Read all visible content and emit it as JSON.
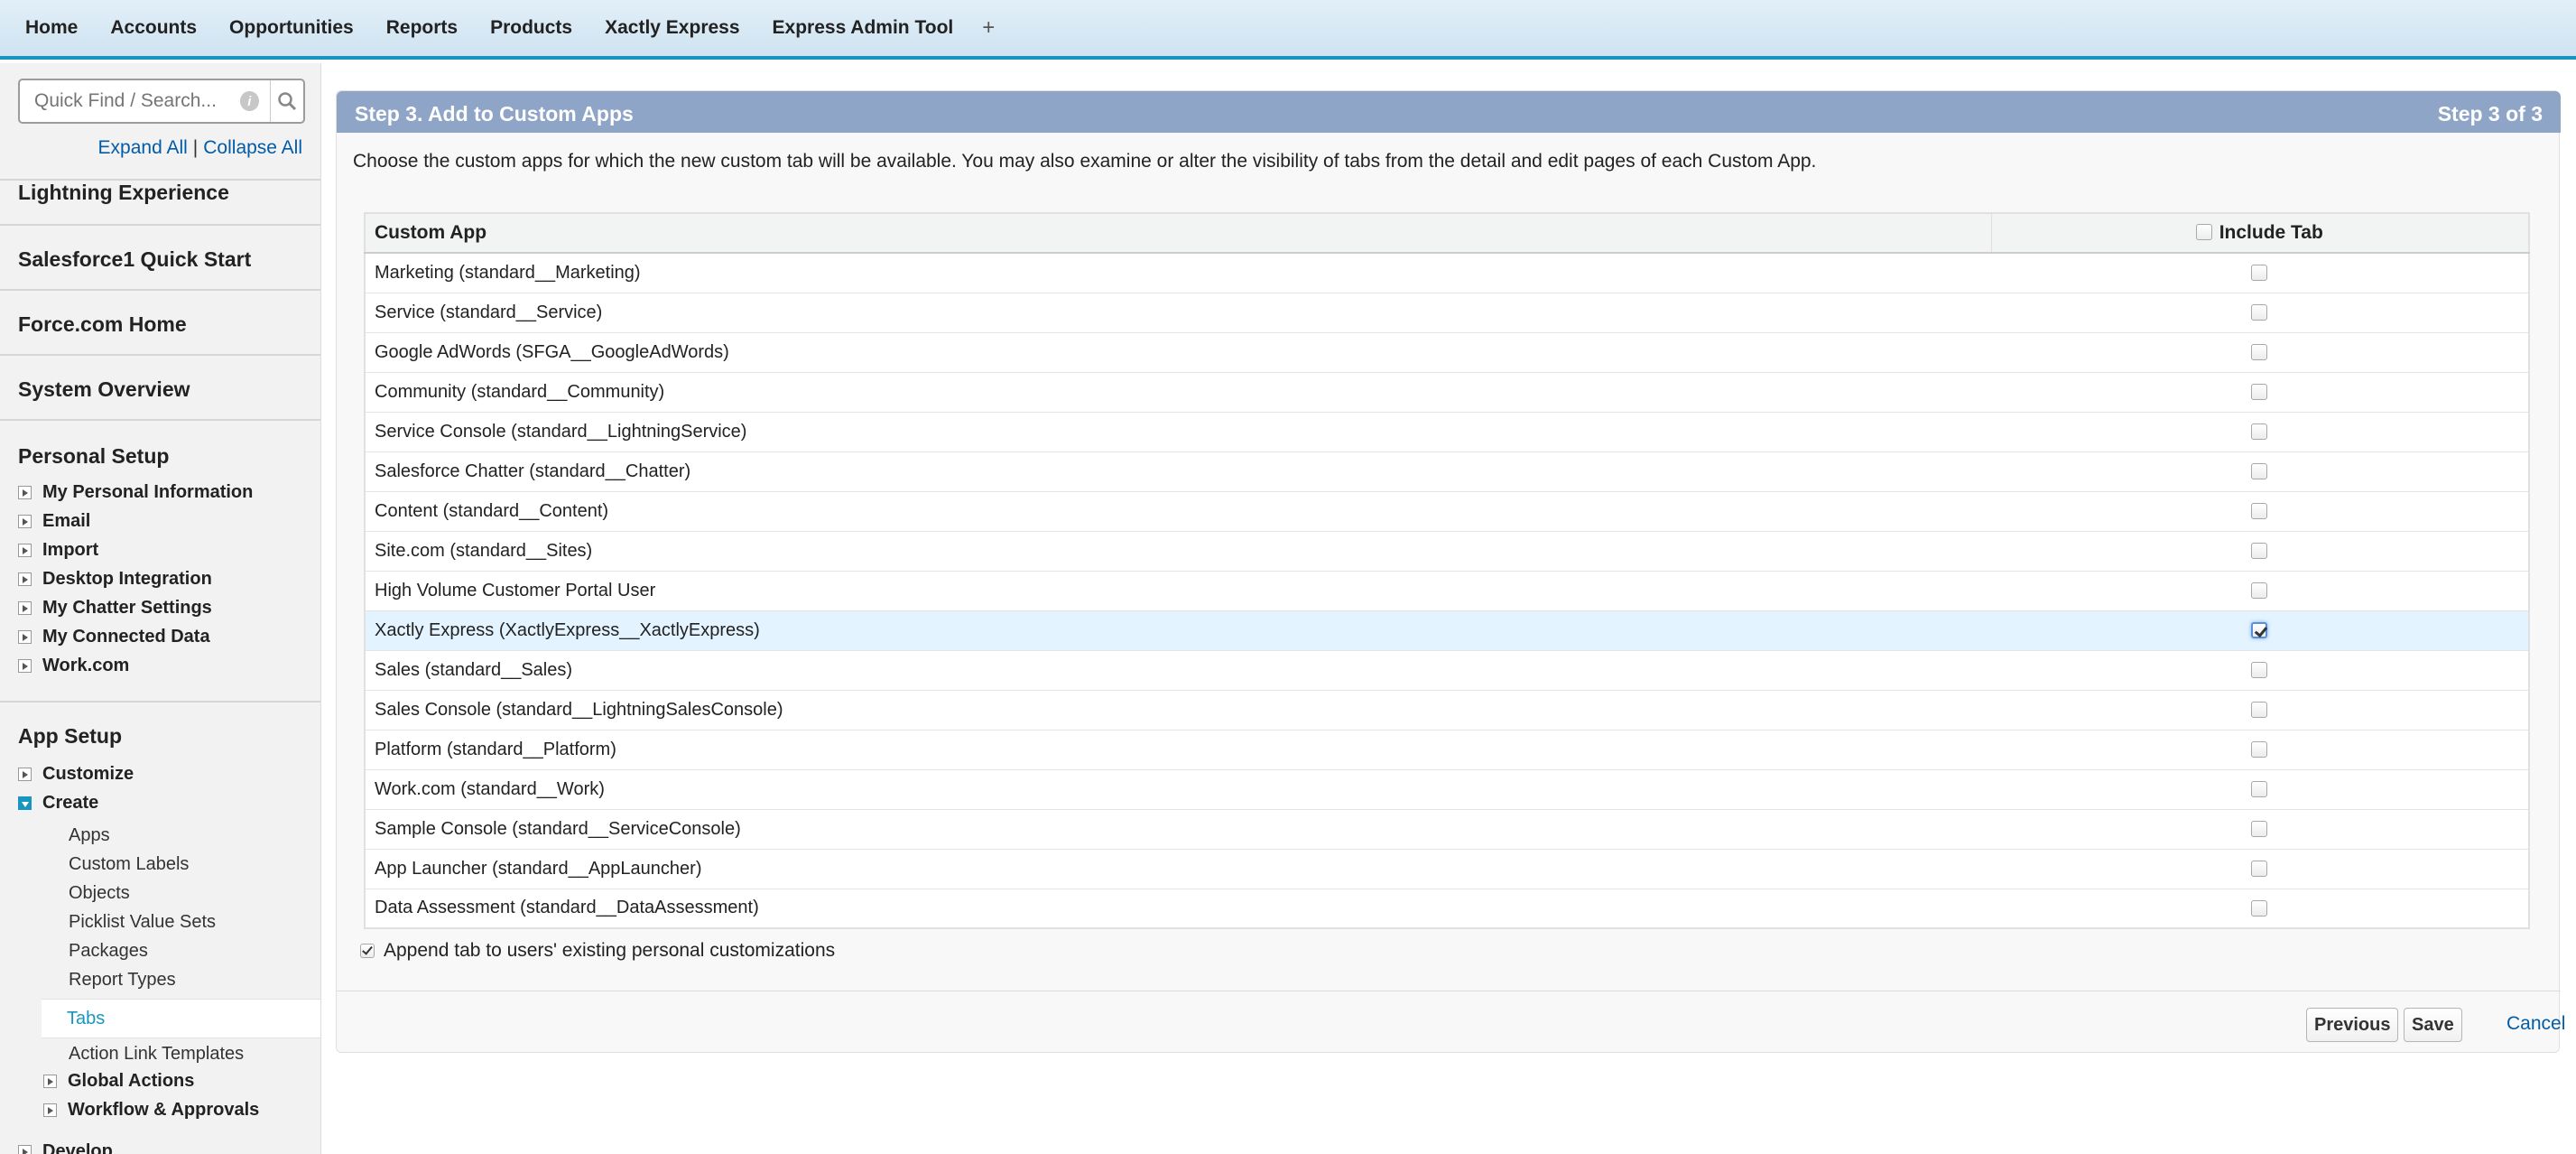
{
  "nav": {
    "tabs": [
      "Home",
      "Accounts",
      "Opportunities",
      "Reports",
      "Products",
      "Xactly Express",
      "Express Admin Tool"
    ],
    "plus": "+"
  },
  "sidebar": {
    "search_placeholder": "Quick Find / Search...",
    "expand_all": "Expand All",
    "separator": "|",
    "collapse_all": "Collapse All",
    "sections": [
      "Lightning Experience",
      "Salesforce1 Quick Start",
      "Force.com Home",
      "System Overview"
    ],
    "personal_setup": "Personal Setup",
    "personal_items": [
      "My Personal Information",
      "Email",
      "Import",
      "Desktop Integration",
      "My Chatter Settings",
      "My Connected Data",
      "Work.com"
    ],
    "app_setup": "App Setup",
    "customize": "Customize",
    "create": "Create",
    "create_items": [
      "Apps",
      "Custom Labels",
      "Objects",
      "Picklist Value Sets",
      "Packages",
      "Report Types"
    ],
    "tabs_selected": "Tabs",
    "action_link": "Action Link Templates",
    "global_actions": "Global Actions",
    "workflow": "Workflow & Approvals",
    "develop": "Develop"
  },
  "main": {
    "step_title": "Step 3. Add to Custom Apps",
    "step_count": "Step 3 of 3",
    "description": "Choose the custom apps for which the new custom tab will be available. You may also examine or alter the visibility of tabs from the detail and edit pages of each Custom App.",
    "col_app": "Custom App",
    "col_include": "Include Tab",
    "rows": [
      {
        "app": "Marketing (standard__Marketing)",
        "checked": false
      },
      {
        "app": "Service (standard__Service)",
        "checked": false
      },
      {
        "app": "Google AdWords (SFGA__GoogleAdWords)",
        "checked": false
      },
      {
        "app": "Community (standard__Community)",
        "checked": false
      },
      {
        "app": "Service Console (standard__LightningService)",
        "checked": false
      },
      {
        "app": "Salesforce Chatter (standard__Chatter)",
        "checked": false
      },
      {
        "app": "Content (standard__Content)",
        "checked": false
      },
      {
        "app": "Site.com (standard__Sites)",
        "checked": false
      },
      {
        "app": "High Volume Customer Portal User",
        "checked": false
      },
      {
        "app": "Xactly Express (XactlyExpress__XactlyExpress)",
        "checked": true
      },
      {
        "app": "Sales (standard__Sales)",
        "checked": false
      },
      {
        "app": "Sales Console (standard__LightningSalesConsole)",
        "checked": false
      },
      {
        "app": "Platform (standard__Platform)",
        "checked": false
      },
      {
        "app": "Work.com (standard__Work)",
        "checked": false
      },
      {
        "app": "Sample Console (standard__ServiceConsole)",
        "checked": false
      },
      {
        "app": "App Launcher (standard__AppLauncher)",
        "checked": false
      },
      {
        "app": "Data Assessment (standard__DataAssessment)",
        "checked": false
      }
    ],
    "append_label": "Append tab to users' existing personal customizations",
    "previous": "Previous",
    "save": "Save",
    "cancel": "Cancel"
  }
}
